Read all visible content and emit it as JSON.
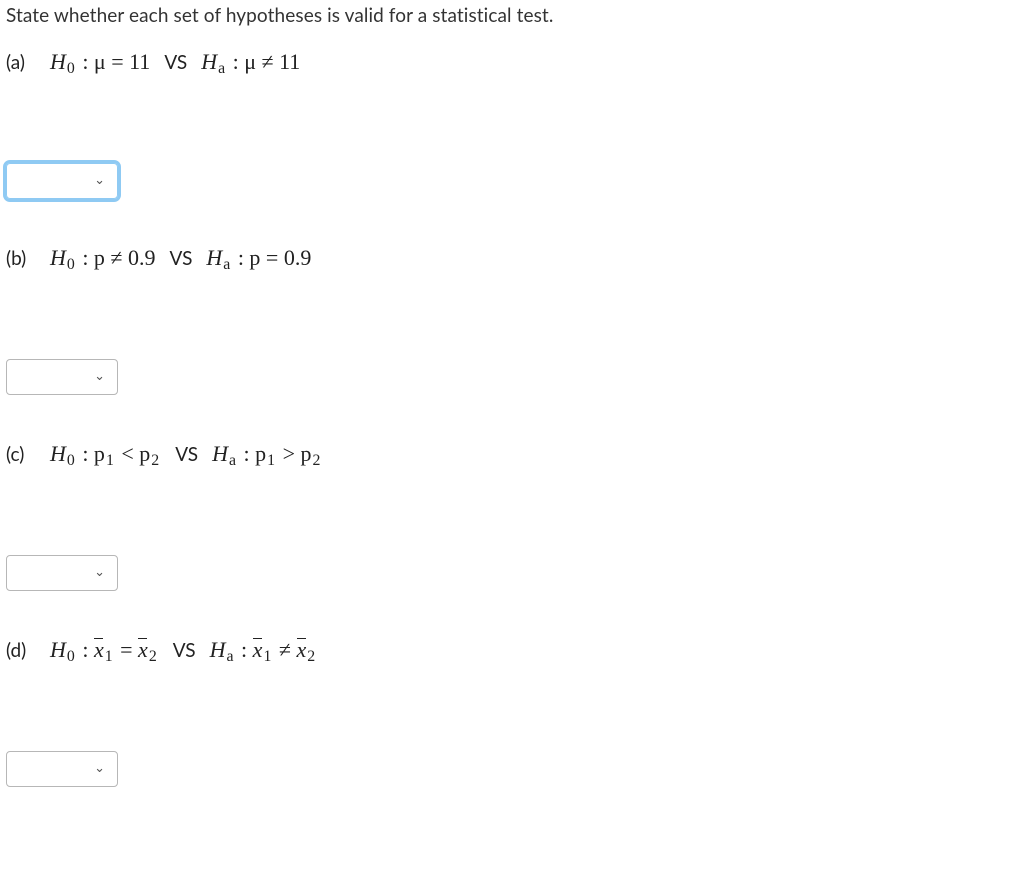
{
  "prompt": "State whether each set of hypotheses is valid for a statistical test.",
  "parts": {
    "a": {
      "label": "(a)",
      "h0_prefix": "H",
      "h0_sub": "0",
      "h0_body": " :  μ = 11",
      "vs": "VS",
      "ha_prefix": "H",
      "ha_sub": "a",
      "ha_body": " :  μ ≠ 11"
    },
    "b": {
      "label": "(b)",
      "h0_prefix": "H",
      "h0_sub": "0",
      "h0_body": " :  p ≠ 0.9",
      "vs": "VS",
      "ha_prefix": "H",
      "ha_sub": "a",
      "ha_body": " :  p = 0.9"
    },
    "c": {
      "label": "(c)",
      "h0_prefix": "H",
      "h0_sub": "0",
      "h0_body_left": " :  p",
      "h0_body_sub": "1",
      "h0_body_mid": " < p",
      "h0_body_sub2": "2",
      "vs": "VS",
      "ha_prefix": "H",
      "ha_sub": "a",
      "ha_body_left": " :  p",
      "ha_body_sub": "1",
      "ha_body_mid": " > p",
      "ha_body_sub2": "2"
    },
    "d": {
      "label": "(d)",
      "h0_prefix": "H",
      "h0_sub": "0",
      "h0_eq": " = ",
      "vs": "VS",
      "ha_prefix": "H",
      "ha_sub": "a",
      "ha_eq": " ≠ ",
      "xbar": "x",
      "sub1": "1",
      "sub2": "2",
      "colon": " :  "
    }
  },
  "dropdowns": {
    "a": {
      "value": "",
      "focused": true
    },
    "b": {
      "value": "",
      "focused": false
    },
    "c": {
      "value": "",
      "focused": false
    },
    "d": {
      "value": "",
      "focused": false
    }
  }
}
